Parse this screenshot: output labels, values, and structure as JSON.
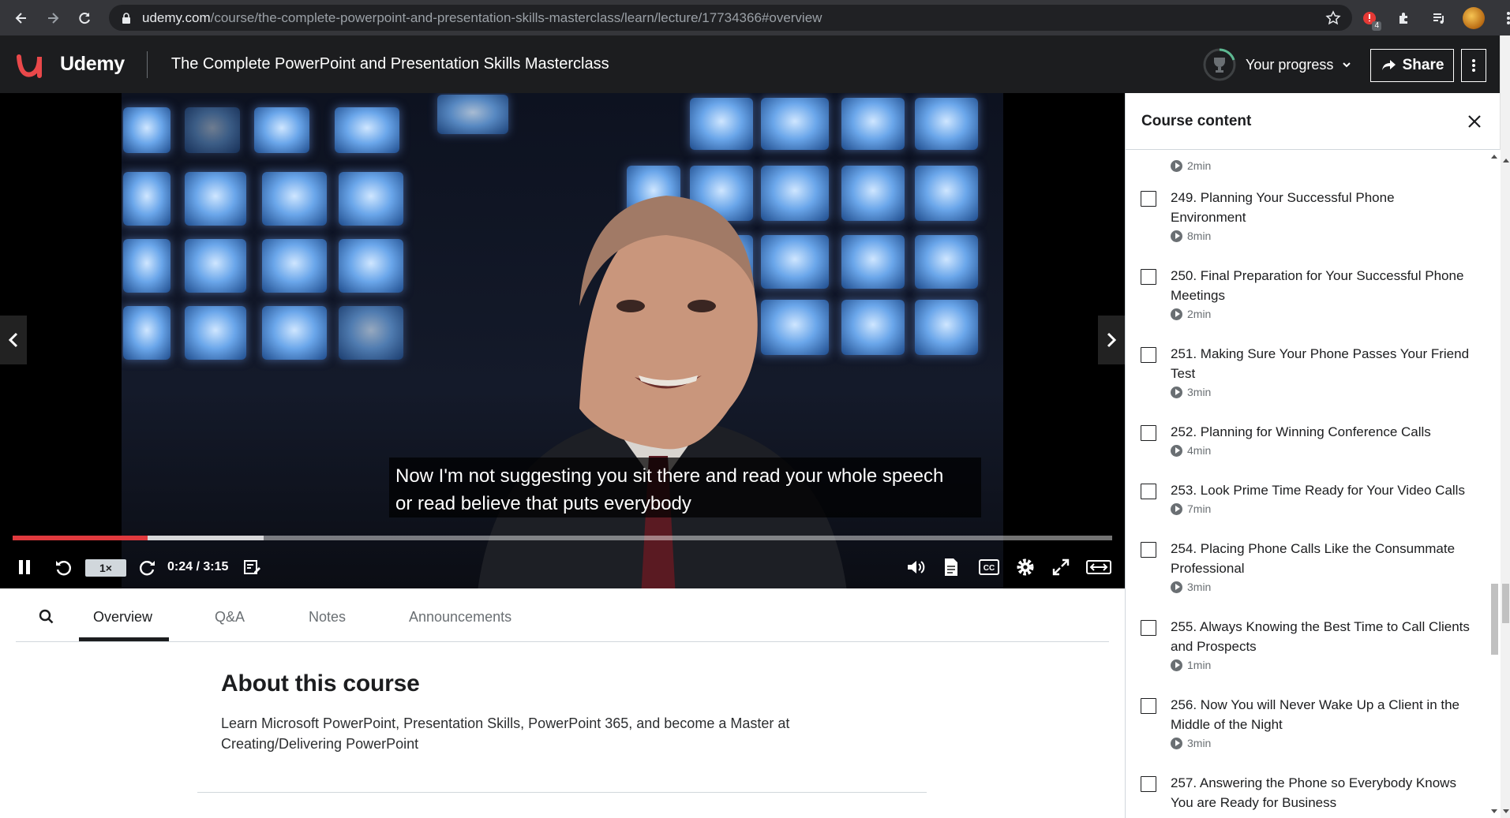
{
  "browser": {
    "url_domain": "udemy.com",
    "url_path": "/course/the-complete-powerpoint-and-presentation-skills-masterclass/learn/lecture/17734366#overview",
    "extension_badge": "4"
  },
  "header": {
    "logo_text": "Udemy",
    "course_title": "The Complete PowerPoint and Presentation Skills Masterclass",
    "progress_label": "Your progress",
    "share_label": "Share"
  },
  "video": {
    "subtitle_line1": "Now I'm not suggesting you sit there and read your whole speech",
    "subtitle_line2": "or read believe that puts everybody",
    "speed": "1×",
    "time": "0:24 / 3:15",
    "progress_fraction": 0.123,
    "buffer_fraction": 0.228
  },
  "tabs": [
    {
      "label": "Overview",
      "active": true
    },
    {
      "label": "Q&A"
    },
    {
      "label": "Notes"
    },
    {
      "label": "Announcements"
    }
  ],
  "about": {
    "title": "About this course",
    "description": "Learn Microsoft PowerPoint, Presentation Skills, PowerPoint 365, and become a Master at Creating/Delivering PowerPoint"
  },
  "sidebar": {
    "title": "Course content",
    "top_duration": "2min",
    "lectures": [
      {
        "title": "249. Planning Your Successful Phone Environment",
        "duration": "8min"
      },
      {
        "title": "250. Final Preparation for Your Successful Phone Meetings",
        "duration": "2min"
      },
      {
        "title": "251. Making Sure Your Phone Passes Your Friend Test",
        "duration": "3min"
      },
      {
        "title": "252. Planning for Winning Conference Calls",
        "duration": "4min"
      },
      {
        "title": "253. Look Prime Time Ready for Your Video Calls",
        "duration": "7min"
      },
      {
        "title": "254. Placing Phone Calls Like the Consummate Professional",
        "duration": "3min"
      },
      {
        "title": "255. Always Knowing the Best Time to Call Clients and Prospects",
        "duration": "1min"
      },
      {
        "title": "256. Now You will Never Wake Up a Client in the Middle of the Night",
        "duration": "3min"
      },
      {
        "title": "257. Answering the Phone so Everybody Knows You are Ready for Business",
        "duration": ""
      }
    ]
  },
  "colors": {
    "brand": "#a435f0",
    "logo_red": "#e9484a",
    "progress_red": "#e03a3e",
    "header_bg": "#1c1d1f"
  }
}
